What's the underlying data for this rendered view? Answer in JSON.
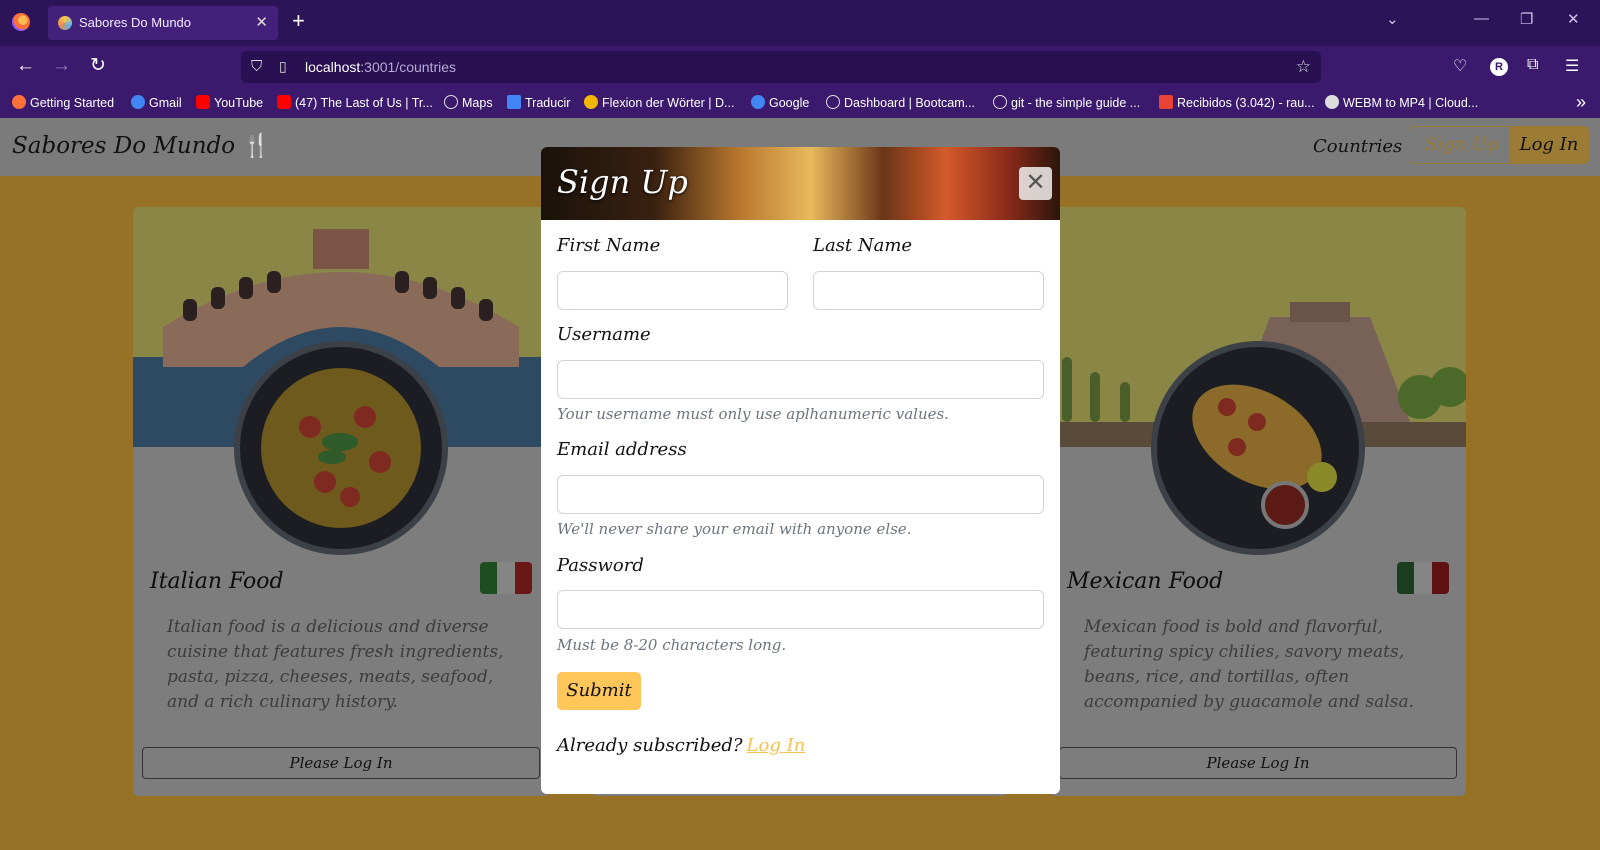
{
  "browser": {
    "tab_title": "Sabores Do Mundo",
    "url_host": "localhost",
    "url_path": ":3001/countries",
    "bookmarks": [
      {
        "label": "Getting Started",
        "icon": "firefox-icon",
        "color": "#ff7139"
      },
      {
        "label": "Gmail",
        "icon": "google-icon",
        "color": "#4285f4"
      },
      {
        "label": "YouTube",
        "icon": "youtube-icon",
        "color": "#ff0000"
      },
      {
        "label": "(47) The Last of Us | Tr...",
        "icon": "youtube-icon",
        "color": "#ff0000"
      },
      {
        "label": "Maps",
        "icon": "globe-icon",
        "color": "#cccccc"
      },
      {
        "label": "Traducir",
        "icon": "translate-icon",
        "color": "#4285f4"
      },
      {
        "label": "Flexion der Wörter | D...",
        "icon": "flag-icon",
        "color": "#f2b705"
      },
      {
        "label": "Google",
        "icon": "google-icon",
        "color": "#4285f4"
      },
      {
        "label": "Dashboard | Bootcam...",
        "icon": "globe-icon",
        "color": "#cccccc"
      },
      {
        "label": "git - the simple guide ...",
        "icon": "globe-icon",
        "color": "#cccccc"
      },
      {
        "label": "Recibidos (3.042) - rau...",
        "icon": "gmail-icon",
        "color": "#ea4335"
      },
      {
        "label": "WEBM to MP4 | Cloud...",
        "icon": "cloud-icon",
        "color": "#dddddd"
      }
    ]
  },
  "site": {
    "brand": "Sabores Do Mundo",
    "brand_icon": "🍴",
    "nav_countries": "Countries",
    "signup_label": "Sign Up",
    "login_label": "Log In"
  },
  "cards": [
    {
      "title": "Italian Food",
      "description": "Italian food is a delicious and diverse cuisine that features fresh ingredients, pasta, pizza, cheeses, meats, seafood, and a rich culinary history.",
      "button": "Please Log In",
      "flag_colors": [
        "#2e7d32",
        "#ffffff",
        "#c62828"
      ]
    },
    {
      "title": "Mexican Food",
      "description": "Mexican food is bold and flavorful, featuring spicy chilies, savory meats, beans, rice, and tortillas, often accompanied by guacamole and salsa.",
      "button": "Please Log In",
      "flag_colors": [
        "#1b5e20",
        "#ffffff",
        "#b71c1c"
      ]
    }
  ],
  "modal": {
    "title": "Sign Up",
    "first_name_label": "First Name",
    "last_name_label": "Last Name",
    "username_label": "Username",
    "username_hint": "Your username must only use aplhanumeric values.",
    "email_label": "Email address",
    "email_hint": "We'll never share your email with anyone else.",
    "password_label": "Password",
    "password_hint": "Must be 8-20 characters long.",
    "submit_label": "Submit",
    "already_text": "Already subscribed?",
    "login_link": "Log In",
    "accent_color": "#ffc65a"
  }
}
